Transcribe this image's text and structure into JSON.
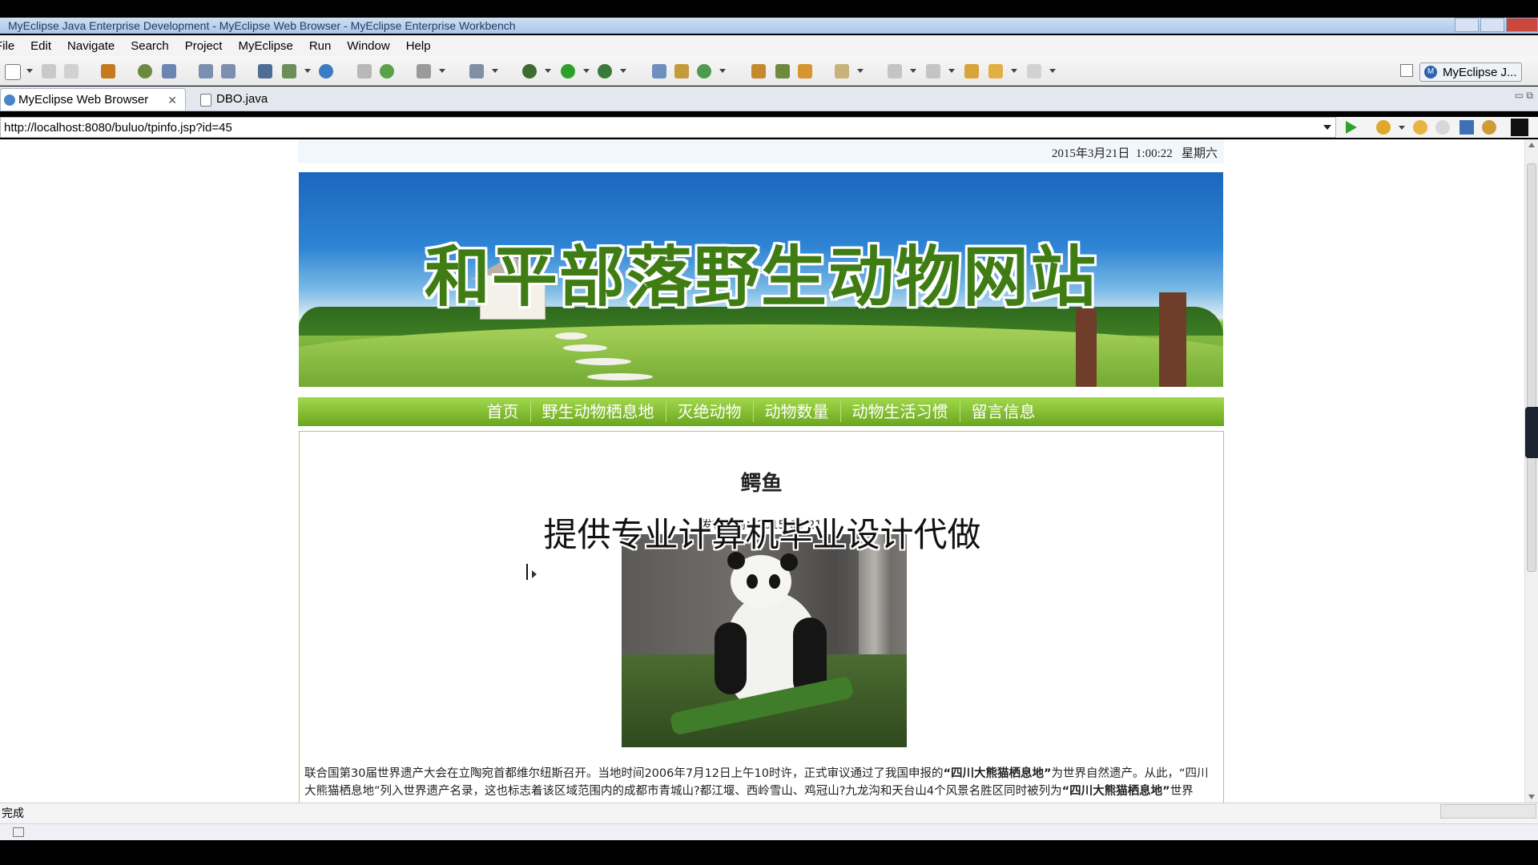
{
  "window": {
    "title": "MyEclipse Java Enterprise Development - MyEclipse Web Browser - MyEclipse Enterprise Workbench"
  },
  "menu": [
    "File",
    "Edit",
    "Navigate",
    "Search",
    "Project",
    "MyEclipse",
    "Run",
    "Window",
    "Help"
  ],
  "perspective": {
    "label": "MyEclipse J..."
  },
  "tabs": [
    {
      "label": "MyEclipse Web Browser",
      "active": true
    },
    {
      "label": "DBO.java",
      "active": false
    }
  ],
  "browser": {
    "url": "http://localhost:8080/buluo/tpinfo.jsp?id=45",
    "status": "完成"
  },
  "page": {
    "datetime": "2015年3月21日  1:00:22   星期六",
    "banner_title": "和平部落野生动物网站",
    "nav": [
      "首页",
      "野生动物栖息地",
      "灭绝动物",
      "动物数量",
      "动物生活习惯",
      "留言信息"
    ],
    "article": {
      "title": "鳄鱼",
      "published_label": "发布时间：",
      "published_date": "2015-03-21",
      "paragraph": {
        "part1": "联合国第30届世界遗产大会在立陶宛首都维尔纽斯召开。当地时间2006年7月12日上午10时许，正式审议通过了我国申报的",
        "strong1": "“四川大熊猫栖息地”",
        "part2": "为世界自然遗产。从此，“四川",
        "line2": "大熊猫栖息地”列入世界遗产名录，这也标志着该区域范围内的成都市青城山?都江堰、西岭雪山、鸡冠山?九龙沟和天台山4个风景名胜区同时被列为",
        "strong2": "“四川大熊猫栖息地”",
        "line2_end": "世界"
      }
    },
    "overlay_text": "提供专业计算机毕业设计代做"
  }
}
